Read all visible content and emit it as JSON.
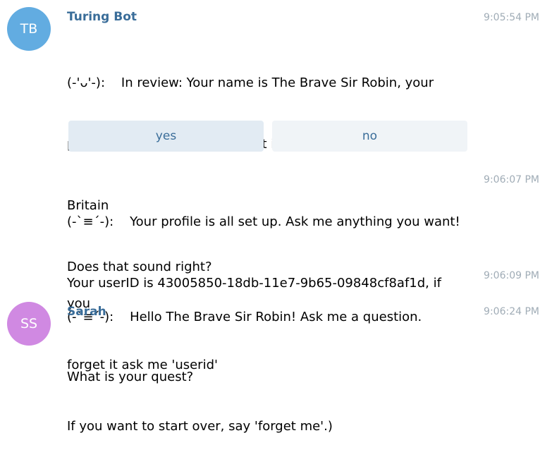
{
  "colors": {
    "bot_avatar": "#62ace1",
    "user_avatar": "#d089e2",
    "sender_name": "#3a6d99",
    "timestamp": "#a0acb6",
    "button_active": "#e2ebf3",
    "button_idle": "#f0f4f7"
  },
  "messages": [
    {
      "avatar_initials": "TB",
      "sender": "Turing Bot",
      "time": "9:05:54 PM",
      "lines": [
        "(-'ᴗ'-):    In review: Your name is The Brave Sir Robin, your",
        "pronouns are He/Him, your diet is Omnivorous, and you live in",
        "Britain",
        "Does that sound right?"
      ],
      "keyboard": [
        "yes",
        "no"
      ]
    },
    {
      "time": "9:06:07 PM",
      "lines": [
        "(-`≡´-):    Your profile is all set up. Ask me anything you want!",
        "Your userID is 43005850-18db-11e7-9b65-09848cf8af1d, if you",
        "forget it ask me 'userid'",
        "If you want to start over, say 'forget me'.)"
      ]
    },
    {
      "time": "9:06:09 PM",
      "lines": [
        "(-`≡´-):    Hello The Brave Sir Robin! Ask me a question."
      ]
    },
    {
      "avatar_initials": "SS",
      "sender": "Sarah",
      "time": "9:06:24 PM",
      "lines": [
        "What is your quest?"
      ]
    }
  ]
}
